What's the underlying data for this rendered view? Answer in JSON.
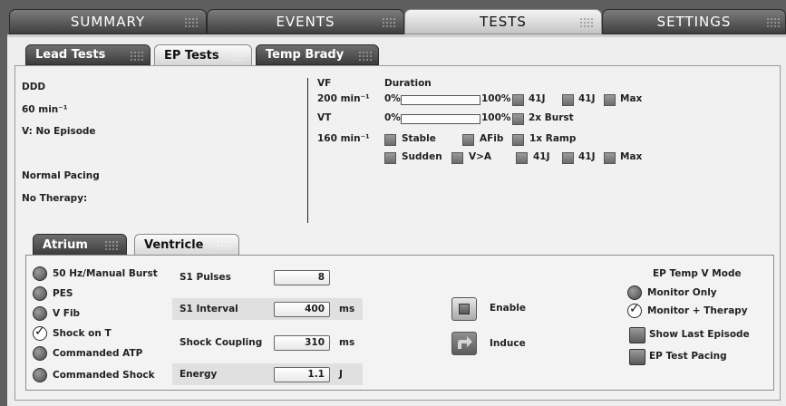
{
  "top_tabs": [
    "SUMMARY",
    "EVENTS",
    "TESTS",
    "SETTINGS"
  ],
  "sub_tabs": [
    "Lead Tests",
    "EP Tests",
    "Temp Brady"
  ],
  "status": {
    "mode": "DDD",
    "rate": "60 min⁻¹",
    "v_episode": "V: No Episode",
    "pacing": "Normal Pacing",
    "therapy": "No Therapy:"
  },
  "zones": {
    "vf_label": "VF",
    "duration_label": "Duration",
    "vf_rate": "200 min⁻¹",
    "vf_bar_min": "0%",
    "vf_bar_max": "100%",
    "vf_bar_value": 0,
    "vf_opts": [
      "41J",
      "41J",
      "Max"
    ],
    "vt_label": "VT",
    "vt_rate": "160 min⁻¹",
    "vt_bar_min": "0%",
    "vt_bar_max": "100%",
    "vt_bar_value": 0,
    "vt_burst": "2x Burst",
    "vt_row1": [
      "Stable",
      "AFib",
      "1x Ramp"
    ],
    "vt_row2": [
      "Sudden",
      "V>A",
      "41J",
      "41J",
      "Max"
    ]
  },
  "chamber_tabs": [
    "Atrium",
    "Ventricle"
  ],
  "options": [
    {
      "label": "50 Hz/Manual Burst",
      "checked": false
    },
    {
      "label": "PES",
      "checked": false
    },
    {
      "label": "V Fib",
      "checked": false
    },
    {
      "label": "Shock on T",
      "checked": true
    },
    {
      "label": "Commanded ATP",
      "checked": false
    },
    {
      "label": "Commanded Shock",
      "checked": false
    }
  ],
  "fields": [
    {
      "label": "S1 Pulses",
      "value": "8",
      "unit": ""
    },
    {
      "label": "S1 Interval",
      "value": "400",
      "unit": "ms"
    },
    {
      "label": "Shock Coupling",
      "value": "310",
      "unit": "ms"
    },
    {
      "label": "Energy",
      "value": "1.1",
      "unit": "J"
    }
  ],
  "actions": {
    "enable": "Enable",
    "induce": "Induce"
  },
  "temp_mode": {
    "title": "EP Temp V Mode",
    "monitor_only": "Monitor Only",
    "monitor_therapy": "Monitor + Therapy",
    "show_last": "Show Last Episode",
    "ep_test_pacing": "EP Test Pacing"
  }
}
